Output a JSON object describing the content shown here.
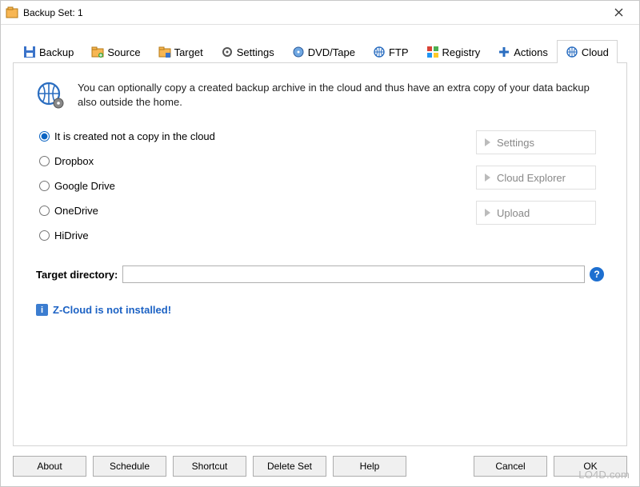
{
  "window": {
    "title": "Backup Set: 1"
  },
  "tabs": [
    {
      "label": "Backup"
    },
    {
      "label": "Source"
    },
    {
      "label": "Target"
    },
    {
      "label": "Settings"
    },
    {
      "label": "DVD/Tape"
    },
    {
      "label": "FTP"
    },
    {
      "label": "Registry"
    },
    {
      "label": "Actions"
    },
    {
      "label": "Cloud"
    }
  ],
  "intro_message": "You can optionally copy a created backup archive in the cloud and thus have an extra copy of your data backup also outside the home.",
  "radio_options": [
    {
      "label": "It is created not a copy in the cloud",
      "selected": true
    },
    {
      "label": "Dropbox",
      "selected": false
    },
    {
      "label": "Google Drive",
      "selected": false
    },
    {
      "label": "OneDrive",
      "selected": false
    },
    {
      "label": "HiDrive",
      "selected": false
    }
  ],
  "side_buttons": {
    "settings": "Settings",
    "cloud_explorer": "Cloud Explorer",
    "upload": "Upload"
  },
  "target": {
    "label": "Target directory:",
    "value": ""
  },
  "warning": "Z-Cloud is not installed!",
  "bottom_buttons": {
    "about": "About",
    "schedule": "Schedule",
    "shortcut": "Shortcut",
    "delete_set": "Delete Set",
    "help": "Help",
    "cancel": "Cancel",
    "ok": "OK"
  },
  "watermark": "LO4D.com"
}
